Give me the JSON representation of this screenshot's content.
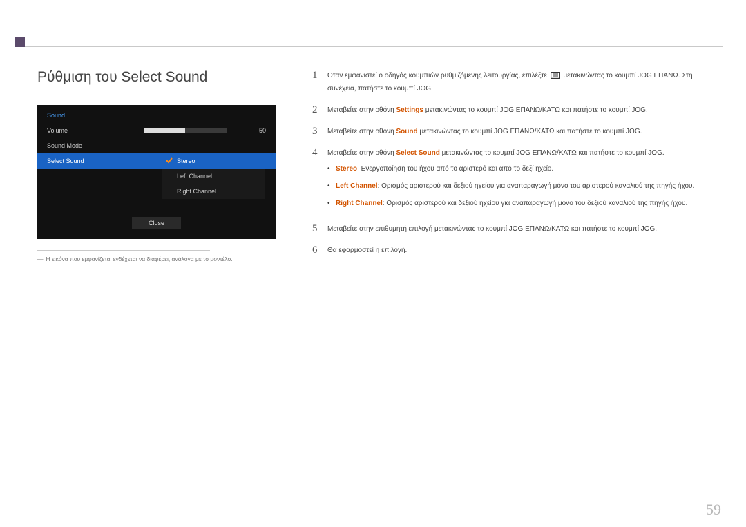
{
  "section_title": "Ρύθμιση του Select Sound",
  "osd": {
    "title": "Sound",
    "volume_label": "Volume",
    "volume_value": "50",
    "soundmode_label": "Sound Mode",
    "selectsound_label": "Select Sound",
    "sub": {
      "stereo": "Stereo",
      "left": "Left Channel",
      "right": "Right Channel"
    },
    "close": "Close"
  },
  "note": "Η εικόνα που εμφανίζεται ενδέχεται να διαφέρει, ανάλογα με το μοντέλο.",
  "steps": {
    "s1a": "Όταν εμφανιστεί ο οδηγός κουμπιών ρυθμιζόμενης λειτουργίας, επιλέξτε ",
    "s1b": " μετακινώντας το κουμπί JOG ΕΠΑΝΩ. Στη συνέχεια, πατήστε το κουμπί JOG.",
    "s2a": "Μεταβείτε στην οθόνη ",
    "s2_settings": "Settings",
    "s2b": " μετακινώντας το κουμπί JOG ΕΠΑΝΩ/ΚΑΤΩ και πατήστε το κουμπί JOG.",
    "s3a": "Μεταβείτε στην οθόνη ",
    "s3_sound": "Sound",
    "s3b": " μετακινώντας το κουμπί JOG ΕΠΑΝΩ/ΚΑΤΩ και πατήστε το κουμπί JOG.",
    "s4a": "Μεταβείτε στην οθόνη ",
    "s4_ss": "Select Sound",
    "s4b": " μετακινώντας το κουμπί JOG ΕΠΑΝΩ/ΚΑΤΩ και πατήστε το κουμπί JOG.",
    "b_stereo_k": "Stereo",
    "b_stereo_v": ": Ενεργοποίηση του ήχου από το αριστερό και από το δεξί ηχείο.",
    "b_left_k": "Left Channel",
    "b_left_v": ": Ορισμός αριστερού και δεξιού ηχείου για αναπαραγωγή μόνο του αριστερού καναλιού της πηγής ήχου.",
    "b_right_k": "Right Channel",
    "b_right_v": ": Ορισμός αριστερού και δεξιού ηχείου για αναπαραγωγή μόνο του δεξιού καναλιού της πηγής ήχου.",
    "s5": "Μεταβείτε στην επιθυμητή επιλογή μετακινώντας το κουμπί JOG ΕΠΑΝΩ/ΚΑΤΩ και πατήστε το κουμπί JOG.",
    "s6": "Θα εφαρμοστεί η επιλογή."
  },
  "nums": {
    "n1": "1",
    "n2": "2",
    "n3": "3",
    "n4": "4",
    "n5": "5",
    "n6": "6"
  },
  "page_number": "59"
}
